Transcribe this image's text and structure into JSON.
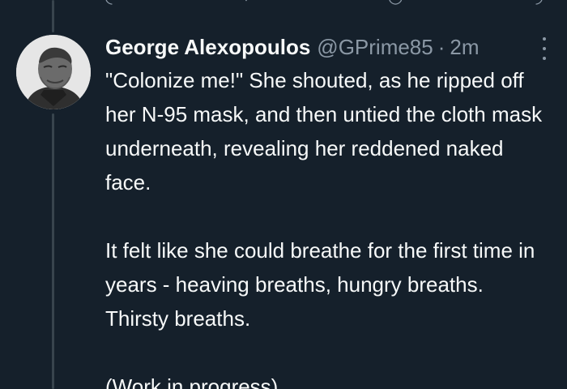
{
  "tweet": {
    "display_name": "George Alexopoulos",
    "handle": "@GPrime85",
    "separator": "·",
    "time": "2m",
    "paragraphs": [
      "\"Colonize me!\" She shouted, as he ripped off her N-95 mask, and then untied the cloth mask underneath, revealing her reddened naked face.",
      "It felt like she could breathe for the first time in years - heaving breaths, hungry breaths. Thirsty breaths.",
      "(Work in progress)"
    ]
  },
  "icons": {
    "more": "more-vertical-icon",
    "avatar": "avatar-photo"
  },
  "colors": {
    "background": "#15202b",
    "primary_text": "#f7f9f9",
    "secondary_text": "#8b98a5",
    "thread_line": "#38444d"
  }
}
